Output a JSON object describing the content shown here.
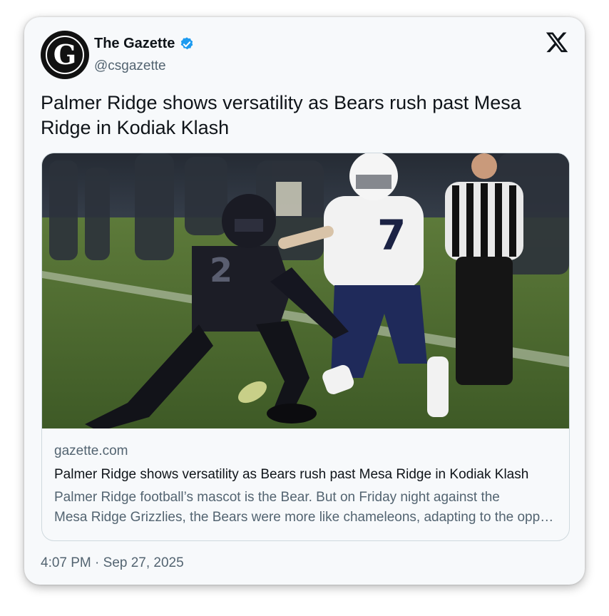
{
  "account": {
    "name": "The Gazette",
    "handle": "@csgazette",
    "avatar_letter": "G"
  },
  "post": {
    "text": "Palmer Ridge shows versatility as Bears rush past Mesa Ridge in Kodiak Klash",
    "timestamp": "4:07 PM · Sep 27, 2025"
  },
  "link_card": {
    "domain": "gazette.com",
    "title": "Palmer Ridge shows versatility as Bears rush past Mesa Ridge in Kodiak Klash",
    "description_line1": "Palmer Ridge football’s mascot is the Bear. But on Friday night against the",
    "description_line2": "Mesa Ridge Grizzlies, the Bears were more like chameleons, adapting to the opponent",
    "jersey_dark": "2",
    "jersey_light": "7"
  },
  "colors": {
    "verified": "#1d9bf0",
    "text_primary": "#0f1419",
    "text_secondary": "#536471",
    "card_bg": "#f7f9fb"
  },
  "icons": [
    "x-logo-icon",
    "verified-badge-icon"
  ]
}
